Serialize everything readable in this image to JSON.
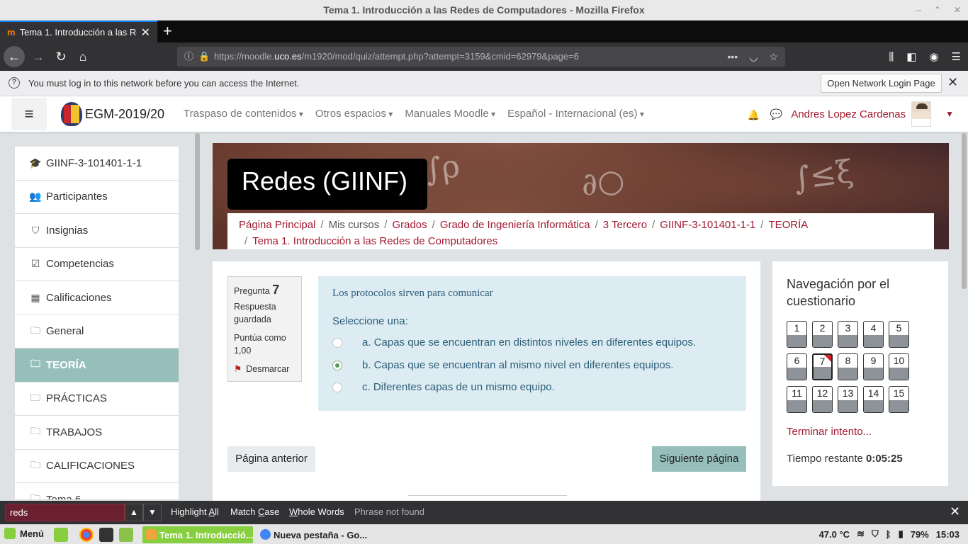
{
  "window": {
    "title": "Tema 1. Introducción a las Redes de Computadores - Mozilla Firefox",
    "controls": [
      "–",
      "⌃",
      "✕"
    ]
  },
  "browser": {
    "tab_title": "Tema 1. Introducción a las Re",
    "new_tab": "+",
    "url_prefix": "https://moodle.",
    "url_host": "uco.es",
    "url_path": "/m1920/mod/quiz/attempt.php?attempt=3159&cmid=62979&page=6"
  },
  "notice": {
    "message": "You must log in to this network before you can access the Internet.",
    "button": "Open Network Login Page"
  },
  "header": {
    "site_name": "EGM-2019/20",
    "menu": [
      "Traspaso de contenidos",
      "Otros espacios",
      "Manuales Moodle",
      "Español - Internacional (es)"
    ],
    "user_name": "Andres Lopez Cardenas"
  },
  "sidebar": {
    "items": [
      {
        "label": "GIINF-3-101401-1-1",
        "icon": "graduation-cap-icon",
        "glyph": "🎓"
      },
      {
        "label": "Participantes",
        "icon": "users-icon",
        "glyph": "👥"
      },
      {
        "label": "Insignias",
        "icon": "shield-icon",
        "glyph": "⛉"
      },
      {
        "label": "Competencias",
        "icon": "checkbox-icon",
        "glyph": "☑"
      },
      {
        "label": "Calificaciones",
        "icon": "table-icon",
        "glyph": "▦"
      },
      {
        "label": "General",
        "icon": "folder-icon",
        "glyph": "🗀"
      },
      {
        "label": "TEORÍA",
        "icon": "folder-icon",
        "glyph": "🗀"
      },
      {
        "label": "PRÁCTICAS",
        "icon": "folder-icon",
        "glyph": "🗀"
      },
      {
        "label": "TRABAJOS",
        "icon": "folder-icon",
        "glyph": "🗀"
      },
      {
        "label": "CALIFICACIONES",
        "icon": "folder-icon",
        "glyph": "🗀"
      },
      {
        "label": "Tema 6",
        "icon": "folder-icon",
        "glyph": "🗀"
      }
    ]
  },
  "course": {
    "title": "Redes (GIINF)",
    "breadcrumb": {
      "home": "Página Principal",
      "mycourses": "Mis cursos",
      "grados": "Grados",
      "grado": "Grado de Ingeniería Informática",
      "tercero": "3 Tercero",
      "course": "GIINF-3-101401-1-1",
      "section": "TEORÍA",
      "activity": "Tema 1. Introducción a las Redes de Computadores"
    }
  },
  "question": {
    "label": "Pregunta",
    "number": "7",
    "state": "Respuesta guardada",
    "grade": "Puntúa como 1,00",
    "flag_label": "Desmarcar",
    "text": "Los protocolos sirven para comunicar",
    "prompt": "Seleccione una:",
    "options": [
      {
        "text": "a. Capas que se encuentran en distintos niveles en diferentes equipos.",
        "selected": false
      },
      {
        "text": "b. Capas que se encuentran al mismo nivel en diferentes equipos.",
        "selected": true
      },
      {
        "text": "c. Diferentes capas de un mismo equipo.",
        "selected": false
      }
    ],
    "prev_button": "Página anterior",
    "next_button": "Siguiente página"
  },
  "quiz_nav": {
    "title": "Navegación por el cuestionario",
    "questions": [
      "1",
      "2",
      "3",
      "4",
      "5",
      "6",
      "7",
      "8",
      "9",
      "10",
      "11",
      "12",
      "13",
      "14",
      "15"
    ],
    "current": "7",
    "finish": "Terminar intento...",
    "time_label": "Tiempo restante",
    "time_value": "0:05:25"
  },
  "findbar": {
    "query": "reds",
    "highlight_pre": "Highlight ",
    "highlight_u": "A",
    "highlight_post": "ll",
    "matchcase_pre": "Match ",
    "matchcase_u": "C",
    "matchcase_post": "ase",
    "wholewords_u": "W",
    "wholewords_post": "hole Words",
    "status": "Phrase not found"
  },
  "taskbar": {
    "menu": "Menú",
    "tasks": [
      "Tema 1. Introducció...",
      "Nueva pestaña - Go..."
    ],
    "temperature": "47.0 °C",
    "battery": "79%",
    "clock": "15:03"
  }
}
